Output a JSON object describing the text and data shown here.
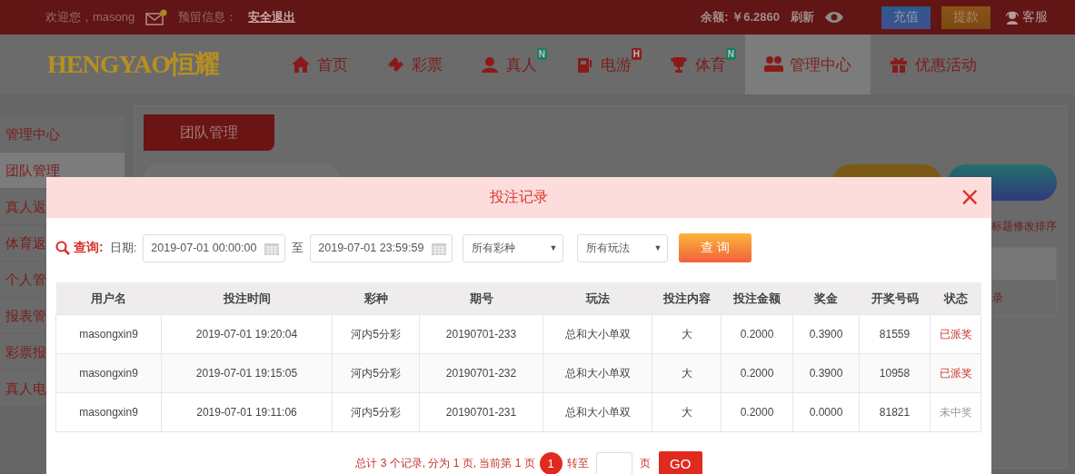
{
  "top_bar": {
    "welcome": "欢迎您，masong",
    "mail_unread": true,
    "reserved_label": "预留信息：",
    "logout": "安全退出",
    "balance": "余额: ￥6.2860",
    "refresh": "刷新",
    "deposit": "充值",
    "withdraw": "提款",
    "service": "客服"
  },
  "logo": "HENGYAO恒耀",
  "nav": [
    {
      "label": "首页",
      "selected": false
    },
    {
      "label": "彩票",
      "selected": false
    },
    {
      "label": "真人",
      "selected": false,
      "badge": {
        "text": "N",
        "color": "#1f7a62"
      }
    },
    {
      "label": "电游",
      "selected": false,
      "badge": {
        "text": "H",
        "color": "#8c1f1f"
      }
    },
    {
      "label": "体育",
      "selected": false,
      "badge": {
        "text": "N",
        "color": "#1f7a62"
      }
    },
    {
      "label": "管理中心",
      "selected": true
    },
    {
      "label": "优惠活动",
      "selected": false
    }
  ],
  "sidebar": {
    "items": [
      {
        "label": "管理中心",
        "selected": false
      },
      {
        "label": "团队管理",
        "selected": true
      },
      {
        "label": "真人返",
        "selected": false
      },
      {
        "label": "体育返",
        "selected": false
      },
      {
        "label": "个人管",
        "selected": false
      },
      {
        "label": "报表管",
        "selected": false
      },
      {
        "label": "彩票报",
        "selected": false
      },
      {
        "label": "真人电",
        "selected": false
      }
    ]
  },
  "panel": {
    "tab": "团队管理",
    "side_note": "标题修改排序",
    "side_cell": "录"
  },
  "modal": {
    "title": "投注记录",
    "close": "×",
    "query": {
      "label": "查询:",
      "date_label": "日期:",
      "from": "2019-07-01 00:00:00",
      "to_label": "至",
      "to": "2019-07-01 23:59:59",
      "lottery": "所有彩种",
      "play": "所有玩法",
      "arrow": "▼",
      "button": "查 询"
    },
    "table": {
      "columns": [
        "用户名",
        "投注时间",
        "彩种",
        "期号",
        "玩法",
        "投注内容",
        "投注金额",
        "奖金",
        "开奖号码",
        "状态"
      ],
      "rows": [
        {
          "cells": [
            "masongxin9",
            "2019-07-01 19:20:04",
            "河内5分彩",
            "20190701-233",
            "总和大小单双",
            "大",
            "0.2000",
            "0.3900",
            "81559"
          ],
          "status": "已派奖",
          "kind": "won"
        },
        {
          "cells": [
            "masongxin9",
            "2019-07-01 19:15:05",
            "河内5分彩",
            "20190701-232",
            "总和大小单双",
            "大",
            "0.2000",
            "0.3900",
            "10958"
          ],
          "status": "已派奖",
          "kind": "won"
        },
        {
          "cells": [
            "masongxin9",
            "2019-07-01 19:11:06",
            "河内5分彩",
            "20190701-231",
            "总和大小单双",
            "大",
            "0.2000",
            "0.0000",
            "81821"
          ],
          "status": "未中奖",
          "kind": "lost"
        }
      ]
    },
    "pager": {
      "summary": "总计 3 个记录, 分为 1 页, 当前第 1 页",
      "page": "1",
      "goto": "转至",
      "unit": "页",
      "go": "GO"
    }
  }
}
